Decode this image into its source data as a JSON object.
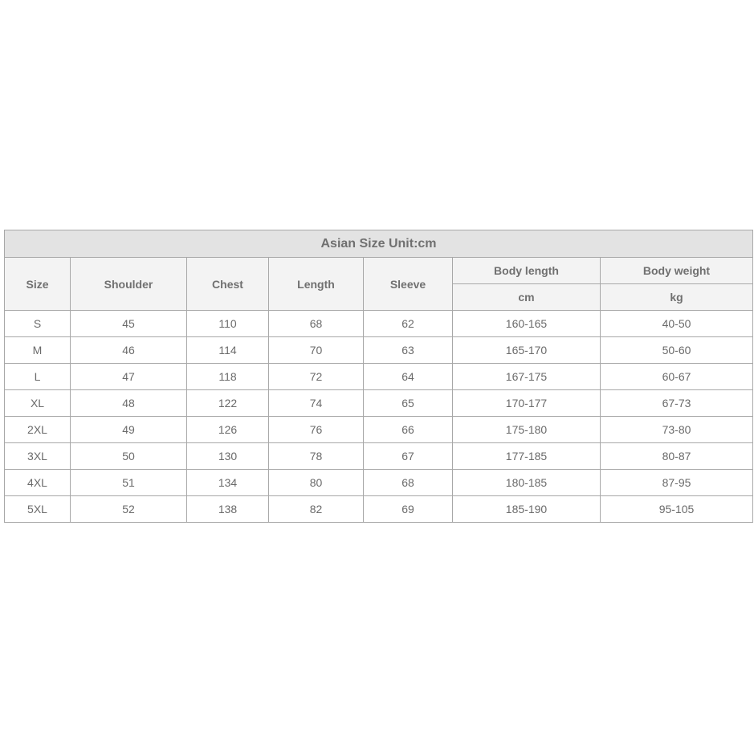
{
  "table": {
    "title": "Asian Size Unit:cm",
    "headers": {
      "size": "Size",
      "shoulder": "Shoulder",
      "chest": "Chest",
      "length": "Length",
      "sleeve": "Sleeve",
      "body_length": "Body length",
      "body_length_unit": "cm",
      "body_weight": "Body weight",
      "body_weight_unit": "kg"
    },
    "rows": [
      [
        "S",
        "45",
        "110",
        "68",
        "62",
        "160-165",
        "40-50"
      ],
      [
        "M",
        "46",
        "114",
        "70",
        "63",
        "165-170",
        "50-60"
      ],
      [
        "L",
        "47",
        "118",
        "72",
        "64",
        "167-175",
        "60-67"
      ],
      [
        "XL",
        "48",
        "122",
        "74",
        "65",
        "170-177",
        "67-73"
      ],
      [
        "2XL",
        "49",
        "126",
        "76",
        "66",
        "175-180",
        "73-80"
      ],
      [
        "3XL",
        "50",
        "130",
        "78",
        "67",
        "177-185",
        "80-87"
      ],
      [
        "4XL",
        "51",
        "134",
        "80",
        "68",
        "180-185",
        "87-95"
      ],
      [
        "5XL",
        "52",
        "138",
        "82",
        "69",
        "185-190",
        "95-105"
      ]
    ]
  }
}
